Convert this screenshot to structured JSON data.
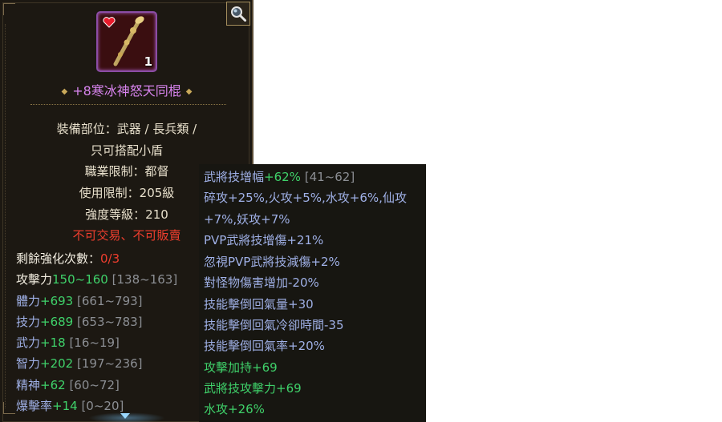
{
  "item": {
    "quantity": "1",
    "name": "+8寒冰神怒天同棍",
    "name_left_deco": "◆",
    "name_right_deco": "◆"
  },
  "info": {
    "slot_line1": "裝備部位：武器 / 長兵類 /",
    "slot_line2": "只可搭配小盾",
    "class_limit": "職業限制：都督",
    "level_limit": "使用限制：205級",
    "strength_level": "強度等級：210",
    "trade_restriction": "不可交易、不可販賣"
  },
  "stats": {
    "enhance_label": "剩餘強化次數：",
    "enhance_value": "0/3",
    "attack_label": "攻擊力",
    "attack_value": "150~160",
    "attack_range": "[138~163]",
    "rows": [
      {
        "label": "體力",
        "value": "+693",
        "range": "[661~793]"
      },
      {
        "label": "技力",
        "value": "+689",
        "range": "[653~783]"
      },
      {
        "label": "武力",
        "value": "+18",
        "range": "[16~19]"
      },
      {
        "label": "智力",
        "value": "+202",
        "range": "[197~236]"
      },
      {
        "label": "精神",
        "value": "+62",
        "range": "[60~72]"
      },
      {
        "label": "爆擊率",
        "value": "+14",
        "range": "[0~20]"
      }
    ]
  },
  "bonus": {
    "skill_amp_label": "武將技增幅",
    "skill_amp_value": "+62%",
    "skill_amp_range": "[41~62]",
    "elem_line1": "碎攻+25%,火攻+5%,水攻+6%,仙攻",
    "elem_line2": "+7%,妖攻+7%",
    "pvp_skill_dmg": "PVP武將技增傷+21%",
    "ignore_pvp": "忽視PVP武將技減傷+2%",
    "monster_dmg": "對怪物傷害增加-20%",
    "knockdown_recover": "技能擊倒回氣量+30",
    "knockdown_cooldown": "技能擊倒回氣冷卻時間-35",
    "knockdown_rate": "技能擊倒回氣率+20%",
    "attack_boost": "攻擊加持+69",
    "skill_attack": "武將技攻擊力+69",
    "water_attack": "水攻+26%"
  },
  "colors": {
    "purple_name": "#d884ee",
    "green_value": "#3fd16a",
    "blue_stat": "#9fb0e6",
    "red_warning": "#ee3e2e",
    "gray_range": "#8c8f94"
  },
  "icons": {
    "search": "magnifier-icon",
    "item": "staff-icon",
    "heart": "heart-icon",
    "scroll": "scroll-down-arrow-icon"
  }
}
